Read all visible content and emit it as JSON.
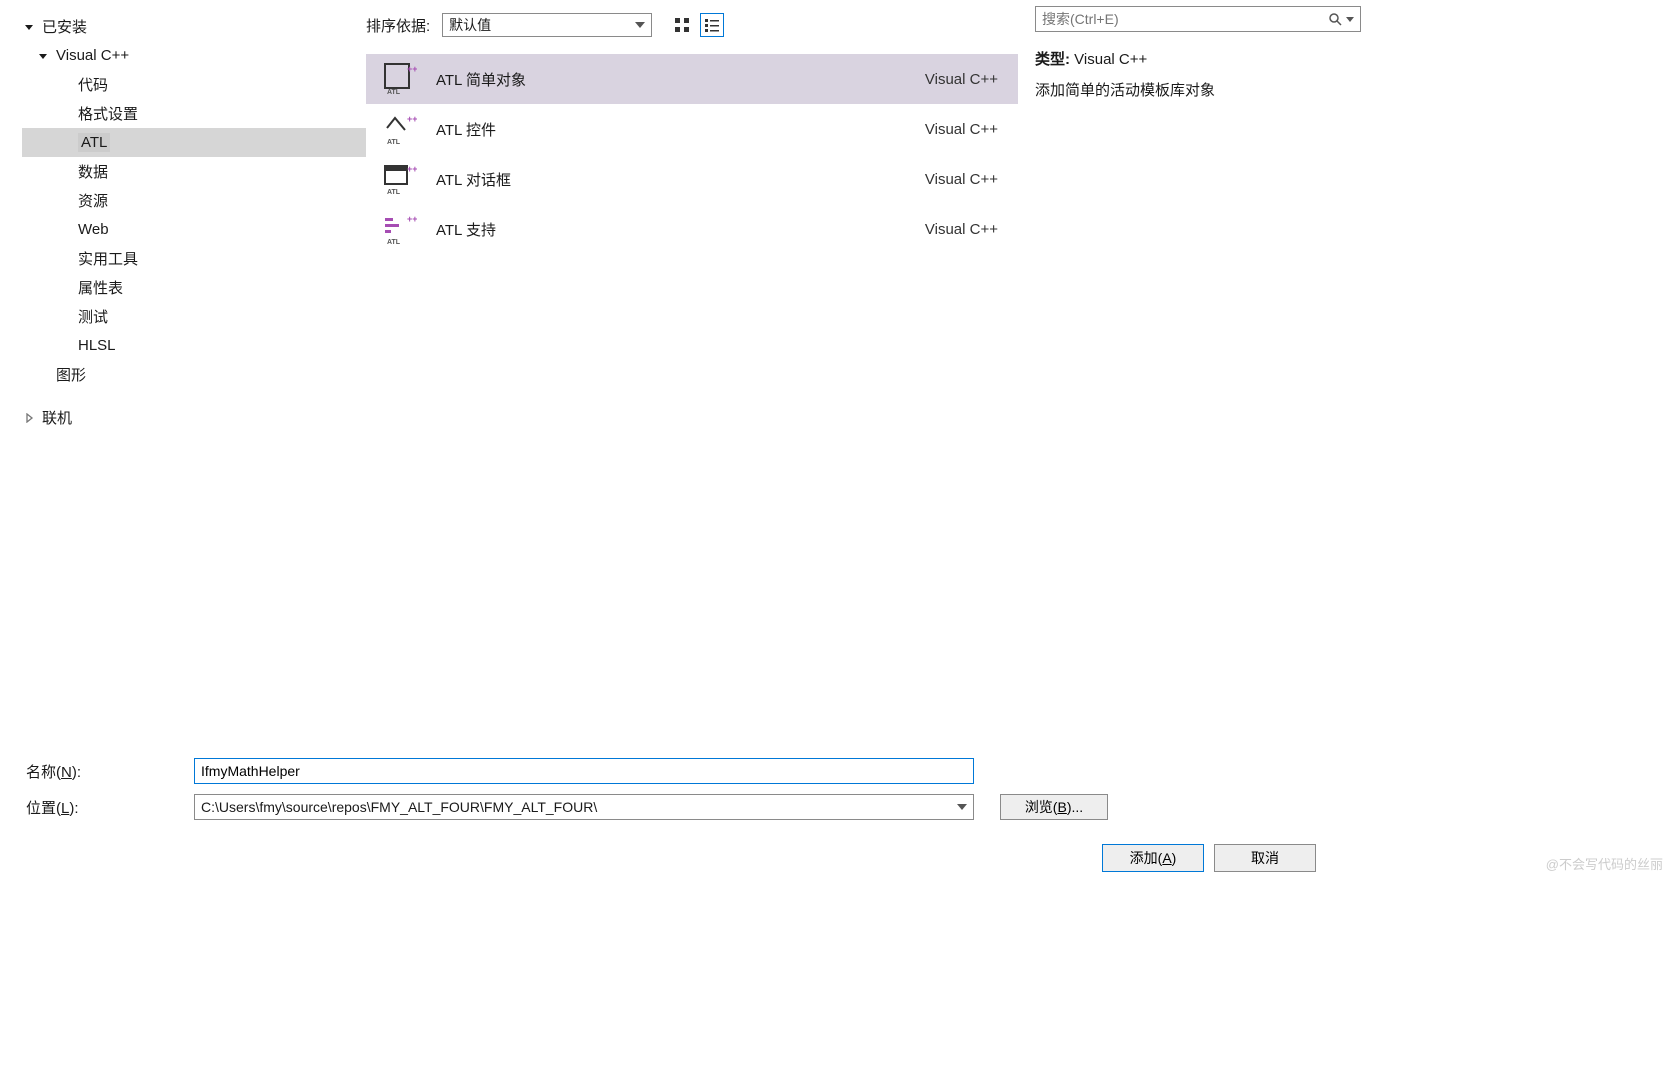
{
  "sidebar": {
    "installed_label": "已安装",
    "visual_cpp": "Visual C++",
    "children": [
      "代码",
      "格式设置",
      "ATL",
      "数据",
      "资源",
      "Web",
      "实用工具",
      "属性表",
      "测试",
      "HLSL"
    ],
    "graphics": "图形",
    "online_label": "联机"
  },
  "header": {
    "sort_label": "排序依据:",
    "sort_value": "默认值"
  },
  "templates": [
    {
      "name": "ATL 简单对象",
      "lang": "Visual C++"
    },
    {
      "name": "ATL 控件",
      "lang": "Visual C++"
    },
    {
      "name": "ATL 对话框",
      "lang": "Visual C++"
    },
    {
      "name": "ATL 支持",
      "lang": "Visual C++"
    }
  ],
  "right": {
    "search_placeholder": "搜索(Ctrl+E)",
    "type_label": "类型:",
    "type_value": "Visual C++",
    "description": "添加简单的活动模板库对象"
  },
  "form": {
    "name_label": "名称(",
    "name_key": "N",
    "name_suffix": "):",
    "name_value": "IfmyMathHelper",
    "location_label": "位置(",
    "location_key": "L",
    "location_suffix": "):",
    "location_value": "C:\\Users\\fmy\\source\\repos\\FMY_ALT_FOUR\\FMY_ALT_FOUR\\",
    "browse_label": "浏览(",
    "browse_key": "B",
    "browse_suffix": ")..."
  },
  "buttons": {
    "add_label": "添加(",
    "add_key": "A",
    "add_suffix": ")",
    "cancel_label": "取消"
  },
  "watermark": "@不会写代码的丝丽"
}
